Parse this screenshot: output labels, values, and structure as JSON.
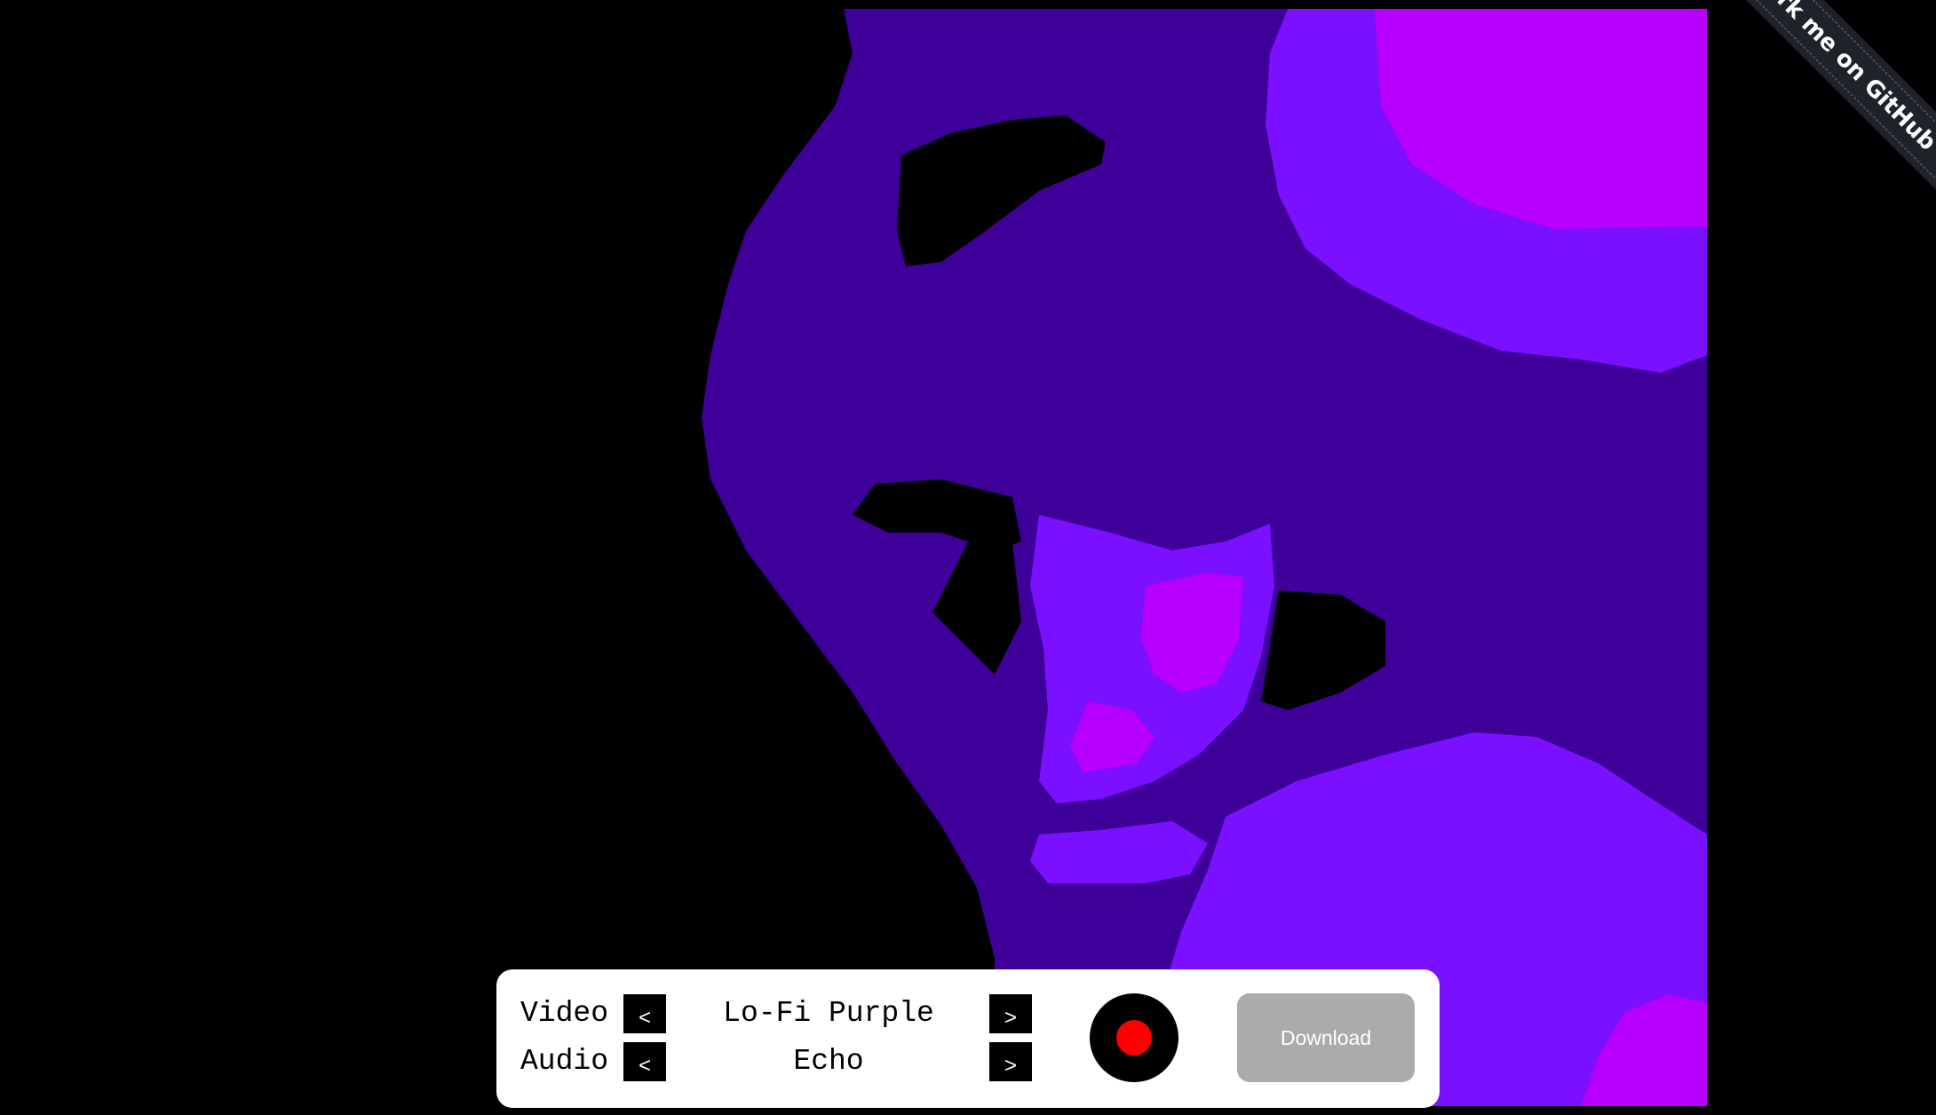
{
  "video_feed": {
    "effect_palette": {
      "black": "#000000",
      "dark_purple": "#3f009a",
      "purple": "#7a10ff",
      "magenta": "#b700ff"
    }
  },
  "controls": {
    "video": {
      "label": "Video",
      "prev_label": "<",
      "effect_name": "Lo-Fi Purple",
      "next_label": ">"
    },
    "audio": {
      "label": "Audio",
      "prev_label": "<",
      "effect_name": "Echo",
      "next_label": ">"
    },
    "record": {
      "icon": "record-icon",
      "dot_color": "#ff0000"
    },
    "download": {
      "label": "Download",
      "color": "#ababab"
    }
  },
  "ribbon": {
    "label": "Fork me on GitHub"
  }
}
